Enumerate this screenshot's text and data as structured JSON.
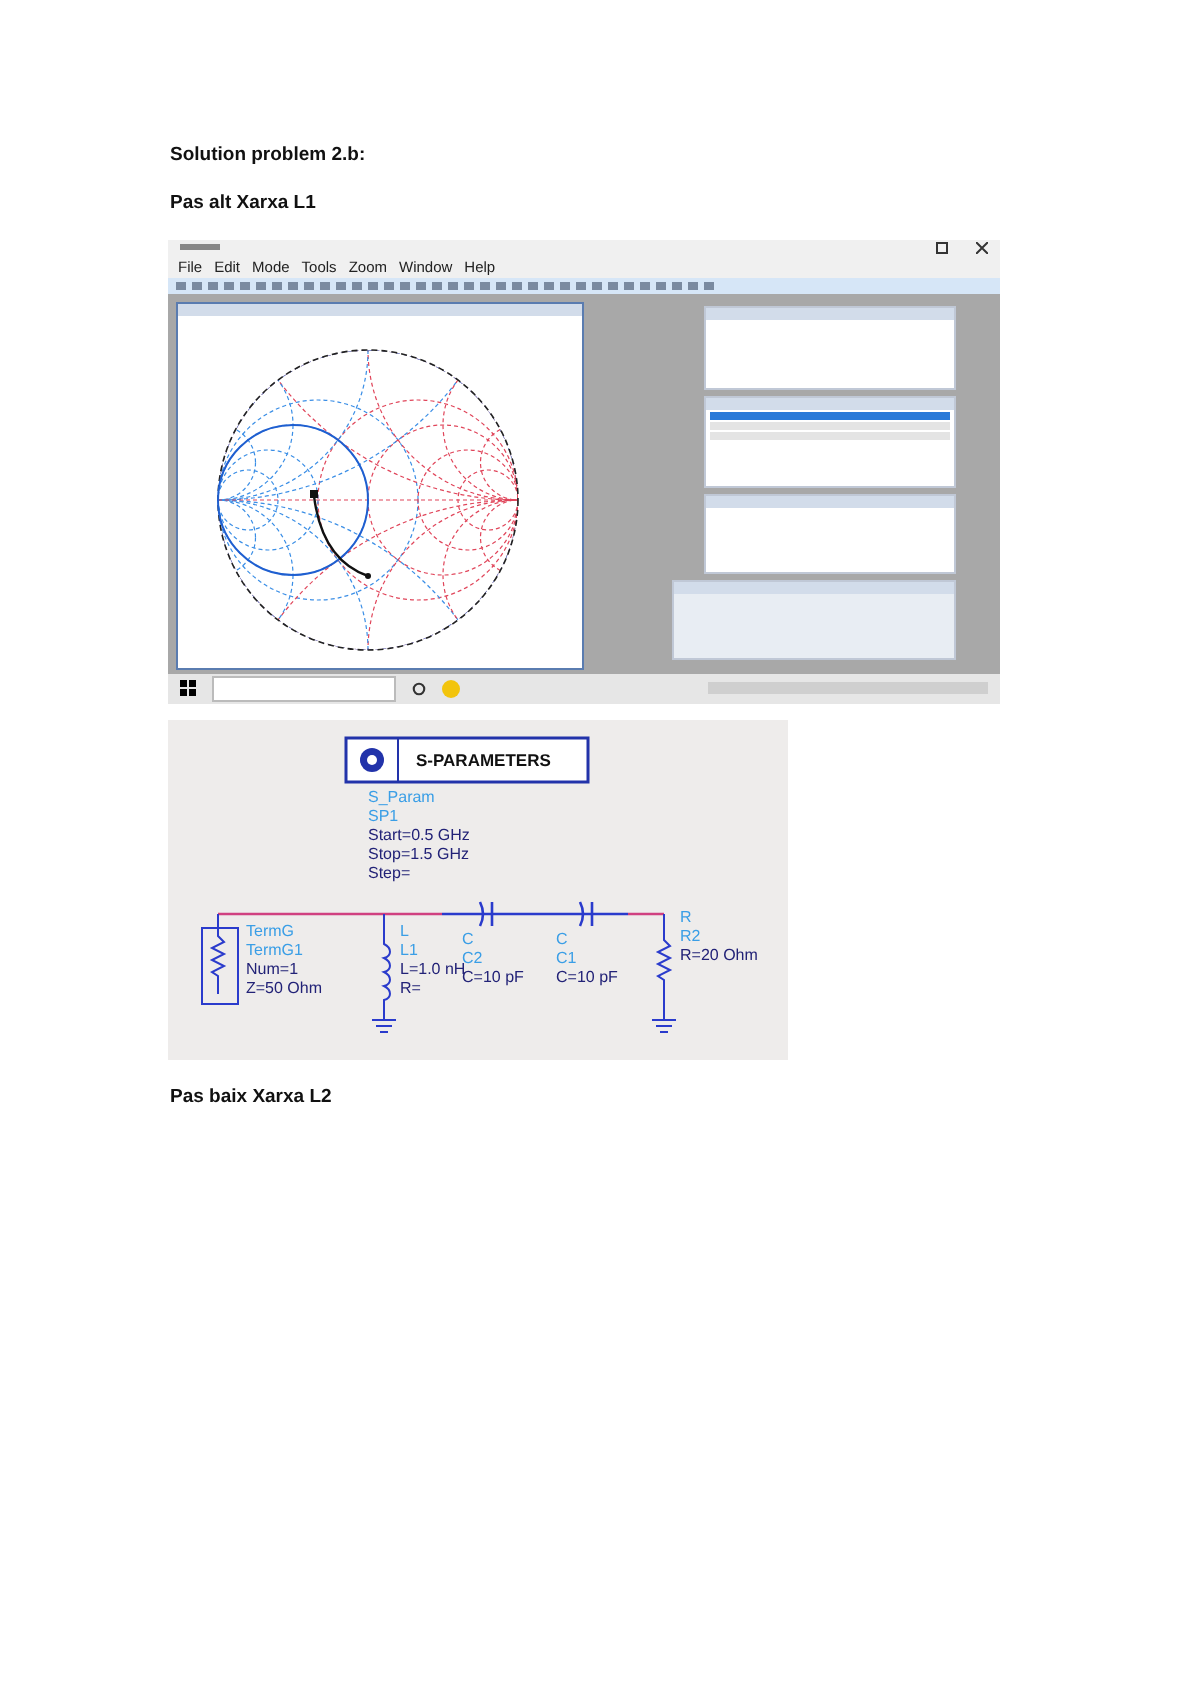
{
  "headings": [
    "Solution problem 2.b:",
    "Pas alt Xarxa L1"
  ],
  "app_window": {
    "menu": [
      "File",
      "Edit",
      "Mode",
      "Tools",
      "Zoom",
      "Window",
      "Help"
    ]
  },
  "schematic": {
    "block_title": "S-PARAMETERS",
    "simulation": {
      "type": "S_Param",
      "lines": [
        "SP1",
        "Start=0.5 GHz",
        "Stop=1.5 GHz",
        "Step="
      ]
    },
    "components": [
      {
        "kind": "port",
        "type": "TermG",
        "lines": [
          "TermG1",
          "Num=1",
          "Z=50 Ohm"
        ]
      },
      {
        "kind": "inductor",
        "type": "L",
        "lines": [
          "L1",
          "L=1.0 nH",
          "R="
        ]
      },
      {
        "kind": "capacitor",
        "type": "C",
        "lines": [
          "C2",
          "C=10 pF"
        ]
      },
      {
        "kind": "capacitor",
        "type": "C",
        "lines": [
          "C1",
          "C=10 pF"
        ]
      },
      {
        "kind": "resistor",
        "type": "R",
        "lines": [
          "R2",
          "R=20 Ohm"
        ]
      }
    ]
  },
  "footer_heading": "Pas baix Xarxa L2"
}
